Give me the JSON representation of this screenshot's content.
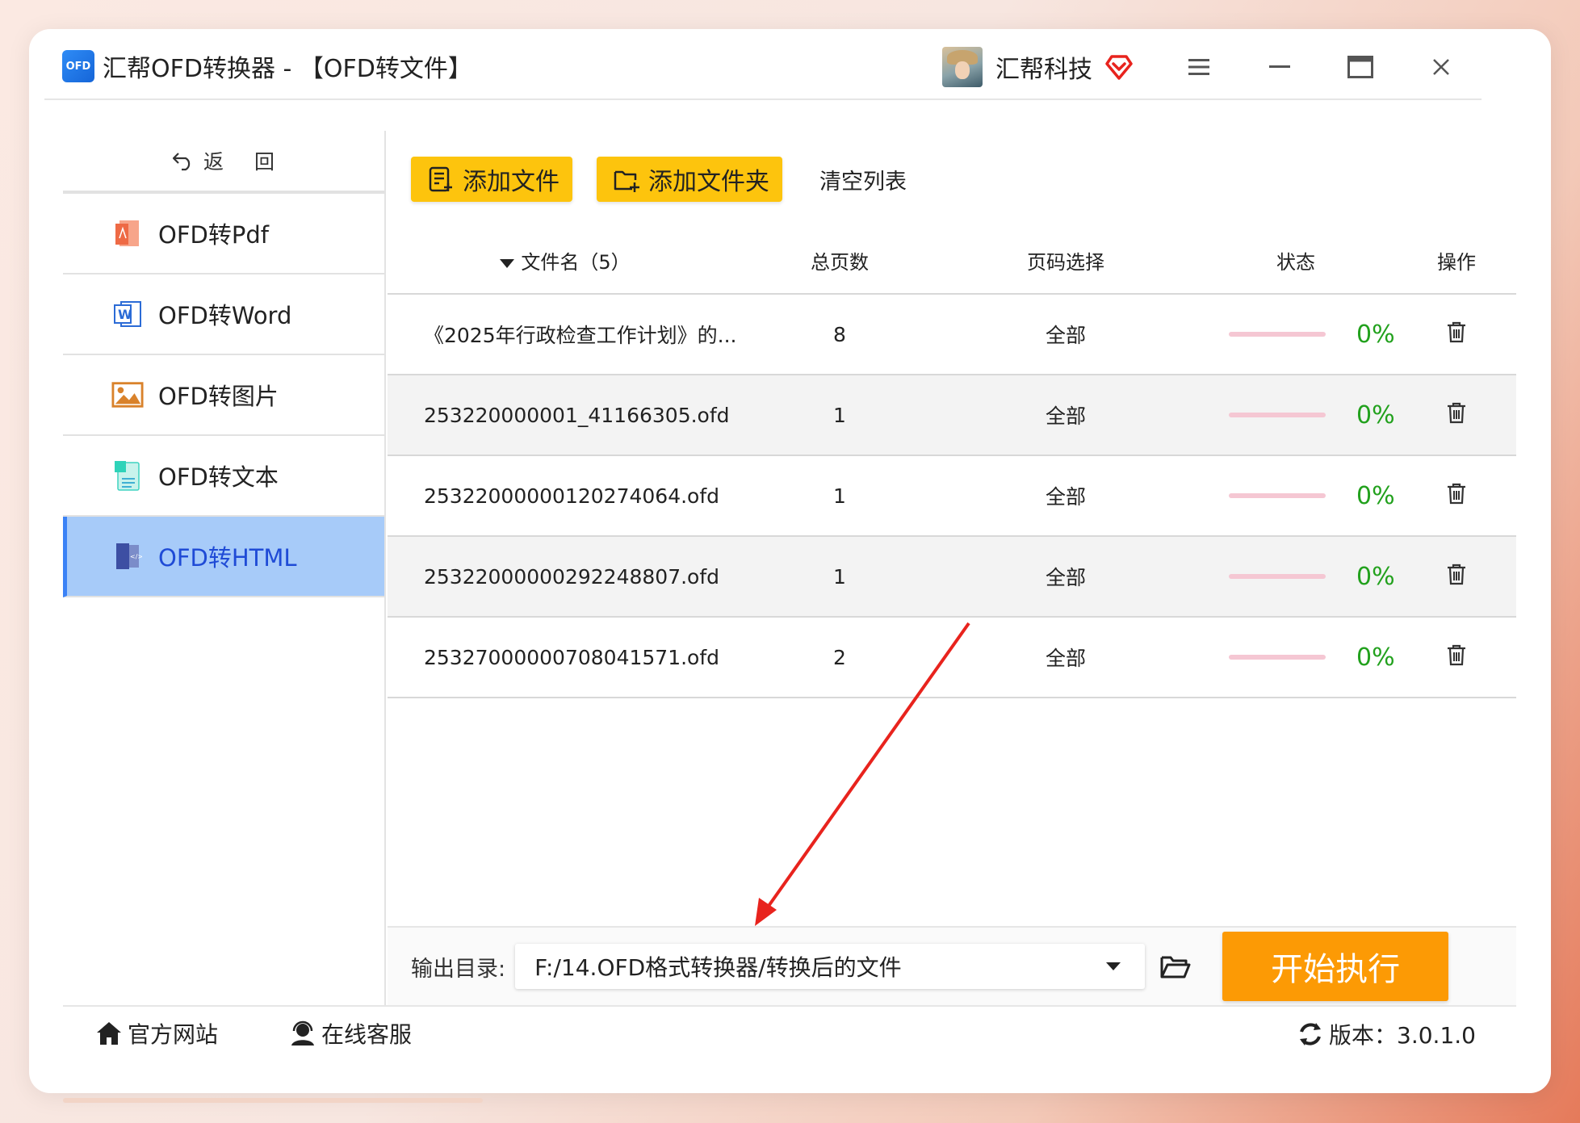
{
  "window": {
    "logo_text": "OFD",
    "title": "汇帮OFD转换器 - 【OFD转文件】",
    "company": "汇帮科技"
  },
  "sidebar": {
    "back_label": "返 回",
    "items": [
      {
        "label": "OFD转Pdf",
        "icon": "pdf-icon",
        "active": false
      },
      {
        "label": "OFD转Word",
        "icon": "word-icon",
        "active": false
      },
      {
        "label": "OFD转图片",
        "icon": "image-icon",
        "active": false
      },
      {
        "label": "OFD转文本",
        "icon": "text-icon",
        "active": false
      },
      {
        "label": "OFD转HTML",
        "icon": "html-icon",
        "active": true
      }
    ]
  },
  "toolbar": {
    "add_file_label": "添加文件",
    "add_folder_label": "添加文件夹",
    "clear_label": "清空列表"
  },
  "table": {
    "headers": {
      "name": "文件名（5）",
      "pages": "总页数",
      "range": "页码选择",
      "status": "状态",
      "op": "操作"
    },
    "rows": [
      {
        "name": "《2025年行政检查工作计划》的...",
        "pages": "8",
        "range": "全部",
        "progress": 0,
        "progress_text": "0%"
      },
      {
        "name": "253220000001_41166305.ofd",
        "pages": "1",
        "range": "全部",
        "progress": 0,
        "progress_text": "0%"
      },
      {
        "name": "25322000000120274064.ofd",
        "pages": "1",
        "range": "全部",
        "progress": 0,
        "progress_text": "0%"
      },
      {
        "name": "25322000000292248807.ofd",
        "pages": "1",
        "range": "全部",
        "progress": 0,
        "progress_text": "0%"
      },
      {
        "name": "25327000000708041571.ofd",
        "pages": "2",
        "range": "全部",
        "progress": 0,
        "progress_text": "0%"
      }
    ]
  },
  "output": {
    "label": "输出目录:",
    "path": "F:/14.OFD格式转换器/转换后的文件",
    "start_label": "开始执行"
  },
  "footer": {
    "website": "官方网站",
    "support": "在线客服",
    "version": "版本：3.0.1.0"
  },
  "colors": {
    "accent_yellow": "#fdc40d",
    "start_orange": "#fc9a05",
    "active_nav": "#a7cbf9",
    "progress_green": "#22a11d",
    "annotation_red": "#e8231d"
  }
}
